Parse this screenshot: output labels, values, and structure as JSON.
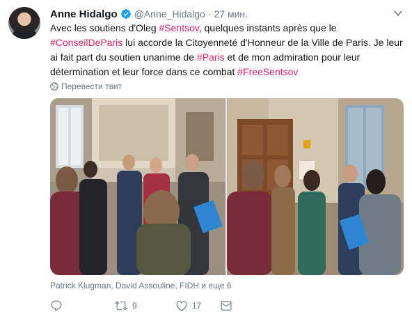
{
  "author": {
    "name": "Anne Hidalgo",
    "handle": "@Anne_Hidalgo",
    "separator": "·",
    "time": "27 мин.",
    "verified": true,
    "avatar_icon": "profile-photo"
  },
  "tweet": {
    "t1": "Avec les soutiens d'Oleg ",
    "t2": "#Sentsov",
    "t3": ", quelques instants après que le ",
    "t4": "#ConseilDeParis",
    "t5": " lui accorde la Citoyenneté d'Honneur de la Ville de Paris. Je leur ai fait part du soutien unanime de ",
    "t6": "#Paris",
    "t7": " et de mon admiration pour leur détermination et leur force dans ce combat ",
    "t8": "#FreeSentsov"
  },
  "translate_label": "Перевести твит",
  "tagged_people": "Patrick Klugman, David Assouline, FIDH и еще 6",
  "actions": {
    "reply_count": "",
    "retweet_count": "9",
    "like_count": "17"
  },
  "colors": {
    "hashtag": "#e0245e",
    "secondary_text": "#657786",
    "verified_badge": "#1da1f2"
  }
}
